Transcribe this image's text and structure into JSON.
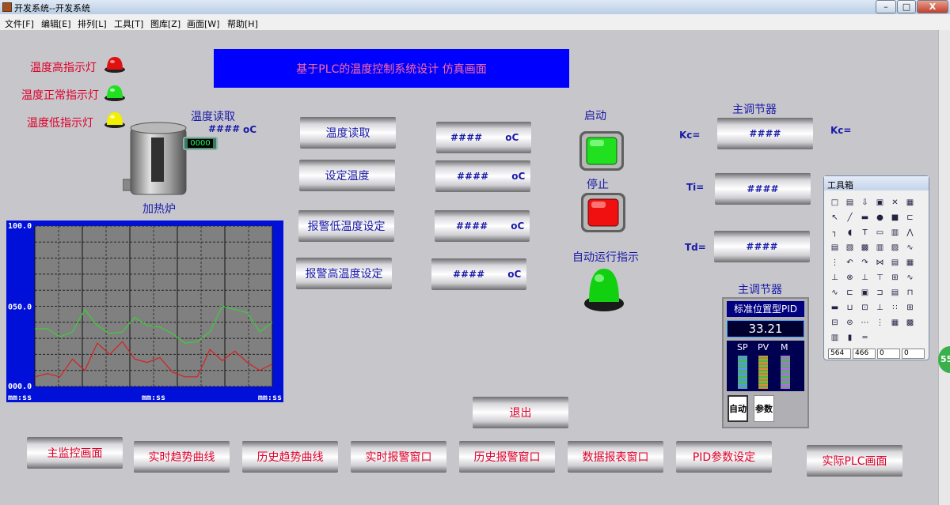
{
  "window": {
    "title": "开发系统--开发系统",
    "minimize": "–",
    "restore": "□",
    "close": "X"
  },
  "menu": [
    "文件[F]",
    "编辑[E]",
    "排列[L]",
    "工具[T]",
    "图库[Z]",
    "画面[W]",
    "帮助[H]"
  ],
  "banner": "基于PLC的温度控制系统设计 仿真画面",
  "indicators": {
    "high": "温度高指示灯",
    "normal": "温度正常指示灯",
    "low": "温度低指示灯"
  },
  "heater": {
    "temp_label": "温度读取",
    "temp_value": "####",
    "temp_unit": "oC",
    "display": "0000",
    "label": "加热炉"
  },
  "setpoints": [
    {
      "label": "温度读取",
      "value": "####",
      "unit": "oC"
    },
    {
      "label": "设定温度",
      "value": "####",
      "unit": "oC"
    },
    {
      "label": "报警低温度设定",
      "value": "####",
      "unit": "oC"
    },
    {
      "label": "报警高温度设定",
      "value": "####",
      "unit": "oC"
    }
  ],
  "controls": {
    "start_label": "启动",
    "stop_label": "停止",
    "run_indicator_label": "自动运行指示",
    "exit": "退出"
  },
  "regulator": {
    "title": "主调节器",
    "kc_label": "Kc=",
    "kc_value": "####",
    "kc_label_right": "Kc=",
    "ti_label": "Ti=",
    "ti_value": "####",
    "td_label": "Td=",
    "td_value": "####"
  },
  "pid_panel": {
    "title": "主调节器",
    "header": "标准位置型PID",
    "value": "33.21",
    "sp": "SP",
    "pv": "PV",
    "m": "M",
    "auto_button": "自动",
    "param_button": "参数"
  },
  "chart_data": {
    "type": "line",
    "ylim": [
      0,
      100
    ],
    "yticks": [
      "100.0",
      "050.0",
      "000.0"
    ],
    "xticks": [
      "mm:ss",
      "mm:ss",
      "mm:ss"
    ],
    "grid": true,
    "series": [
      {
        "color": "#38d038",
        "values": [
          36,
          36,
          31,
          34,
          48,
          38,
          33,
          34,
          43,
          38,
          37,
          33,
          27,
          28,
          34,
          50,
          48,
          46,
          34,
          40
        ]
      },
      {
        "color": "#d82020",
        "values": [
          6,
          8,
          6,
          17,
          10,
          27,
          20,
          28,
          17,
          15,
          18,
          9,
          6,
          6,
          23,
          16,
          22,
          15,
          10,
          14
        ]
      }
    ]
  },
  "toolbox": {
    "title": "工具箱",
    "coords": [
      "564",
      "466",
      "0",
      "0"
    ]
  },
  "nav_buttons": [
    "主监控画面",
    "实时趋势曲线",
    "历史趋势曲线",
    "实时报警窗口",
    "历史报警窗口",
    "数据报表窗口",
    "PID参数设定",
    "实际PLC画面"
  ],
  "side_badge": "55"
}
